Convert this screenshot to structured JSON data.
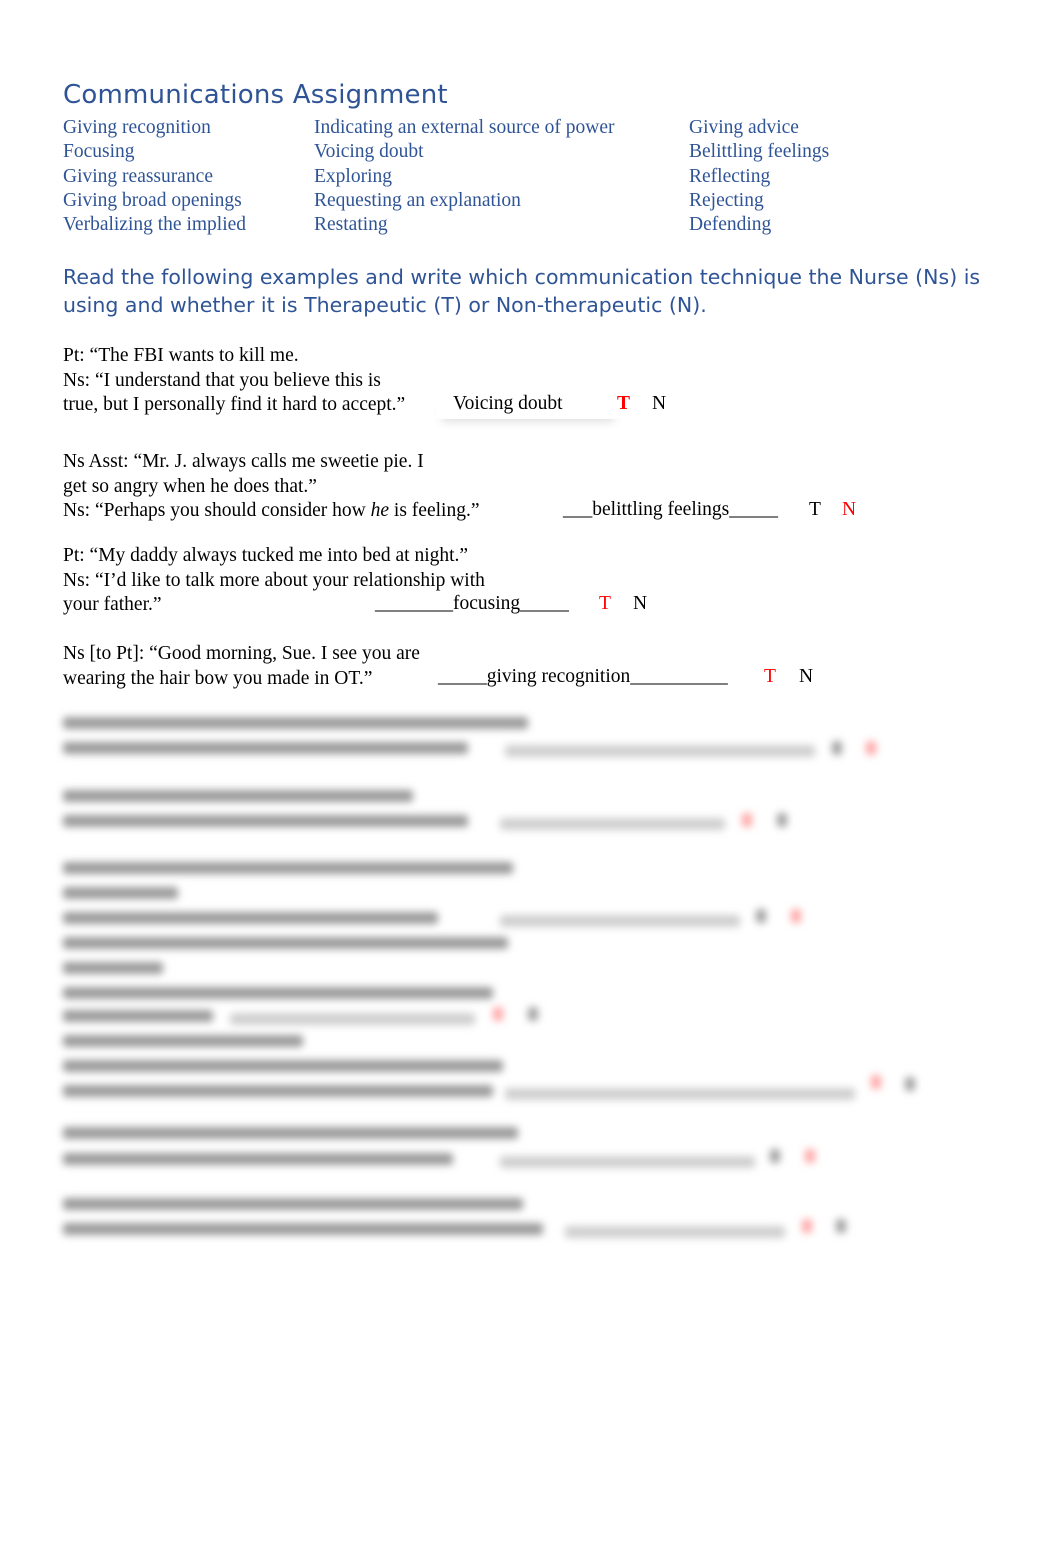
{
  "document": {
    "title": "Communications Assignment",
    "technique_columns": [
      [
        "Giving recognition",
        "Focusing",
        "Giving reassurance",
        "Giving broad openings",
        "Verbalizing the implied"
      ],
      [
        "Indicating an external source of power",
        "Voicing doubt",
        "Exploring",
        "Requesting an explanation",
        "Restating"
      ],
      [
        "Giving advice",
        "Belittling feelings",
        "Reflecting",
        "Rejecting",
        "Defending"
      ]
    ],
    "instructions": "Read the following examples and write which communication technique the Nurse (Ns) is using and whether it is Therapeutic (T) or Non-therapeutic (N).",
    "examples": [
      {
        "lines": [
          "Pt: “The FBI wants to kill me.",
          "Ns: “I understand that you believe this is",
          "true, but I personally find it hard to accept.”"
        ],
        "answer": "Voicing doubt",
        "t_label": "T",
        "n_label": "N",
        "selected": "T"
      },
      {
        "lines": [
          "Ns Asst: “Mr. J. always calls me sweetie pie. I",
          "get so angry when he does that.”"
        ],
        "line3_pre": "Ns: “Perhaps you should consider how ",
        "line3_em": "he",
        "line3_post": " is feeling.”",
        "answer": "___belittling feelings_____",
        "t_label": "T",
        "n_label": "N",
        "selected": "N"
      },
      {
        "lines": [
          "Pt: “My daddy always tucked me into bed at night.”",
          "Ns: “I’d like to talk more about your relationship with",
          "your father.”"
        ],
        "answer": "________focusing_____",
        "t_label": "T",
        "n_label": "N",
        "selected": "T"
      },
      {
        "lines": [
          "Ns [to Pt]: “Good morning, Sue. I see you are",
          "wearing the hair bow you made in OT.”"
        ],
        "answer": "_____giving recognition__________",
        "t_label": "T",
        "n_label": "N",
        "selected": "T"
      }
    ],
    "obscured_examples": [
      {
        "obscured": true,
        "selected": "N"
      },
      {
        "obscured": true,
        "selected": "T"
      },
      {
        "obscured": true,
        "selected": "N"
      },
      {
        "obscured": true,
        "selected": "T"
      },
      {
        "obscured": true,
        "selected": "T"
      },
      {
        "obscured": true,
        "selected": "N"
      },
      {
        "obscured": true,
        "selected": "T"
      }
    ],
    "colors": {
      "heading": "#2f5496",
      "selected_answer": "#ff0000",
      "body_text": "#000000"
    }
  }
}
